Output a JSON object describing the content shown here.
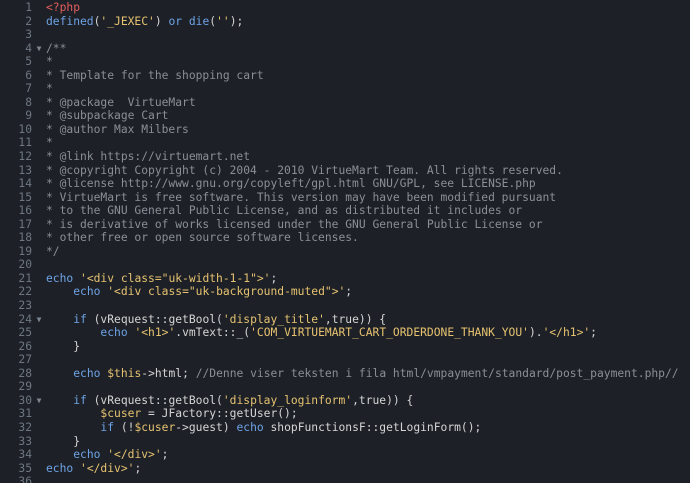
{
  "editor": {
    "lines": [
      {
        "n": "1",
        "fold": "",
        "tokens": [
          {
            "t": "<?php",
            "c": "tag"
          }
        ]
      },
      {
        "n": "2",
        "fold": "",
        "tokens": [
          {
            "t": "defined",
            "c": "kw"
          },
          {
            "t": "(",
            "c": "txt"
          },
          {
            "t": "'_JEXEC'",
            "c": "str"
          },
          {
            "t": ") ",
            "c": "txt"
          },
          {
            "t": "or",
            "c": "kw"
          },
          {
            "t": " ",
            "c": "txt"
          },
          {
            "t": "die",
            "c": "kw"
          },
          {
            "t": "(",
            "c": "txt"
          },
          {
            "t": "''",
            "c": "str"
          },
          {
            "t": ");",
            "c": "txt"
          }
        ]
      },
      {
        "n": "3",
        "fold": "",
        "tokens": []
      },
      {
        "n": "4",
        "fold": "▼",
        "tokens": [
          {
            "t": "/**",
            "c": "cmt"
          }
        ]
      },
      {
        "n": "5",
        "fold": "",
        "tokens": [
          {
            "t": "*",
            "c": "cmt"
          }
        ]
      },
      {
        "n": "6",
        "fold": "",
        "tokens": [
          {
            "t": "* Template for the shopping cart",
            "c": "cmt"
          }
        ]
      },
      {
        "n": "7",
        "fold": "",
        "tokens": [
          {
            "t": "*",
            "c": "cmt"
          }
        ]
      },
      {
        "n": "8",
        "fold": "",
        "tokens": [
          {
            "t": "* @package  VirtueMart",
            "c": "cmt"
          }
        ]
      },
      {
        "n": "9",
        "fold": "",
        "tokens": [
          {
            "t": "* @subpackage Cart",
            "c": "cmt"
          }
        ]
      },
      {
        "n": "10",
        "fold": "",
        "tokens": [
          {
            "t": "* @author Max Milbers",
            "c": "cmt"
          }
        ]
      },
      {
        "n": "11",
        "fold": "",
        "tokens": [
          {
            "t": "*",
            "c": "cmt"
          }
        ]
      },
      {
        "n": "12",
        "fold": "",
        "tokens": [
          {
            "t": "* @link https://virtuemart.net",
            "c": "cmt"
          }
        ]
      },
      {
        "n": "13",
        "fold": "",
        "tokens": [
          {
            "t": "* @copyright Copyright (c) 2004 - 2010 VirtueMart Team. All rights reserved.",
            "c": "cmt"
          }
        ]
      },
      {
        "n": "14",
        "fold": "",
        "tokens": [
          {
            "t": "* @license http://www.gnu.org/copyleft/gpl.html GNU/GPL, see LICENSE.php",
            "c": "cmt"
          }
        ]
      },
      {
        "n": "15",
        "fold": "",
        "tokens": [
          {
            "t": "* VirtueMart is free software. This version may have been modified pursuant",
            "c": "cmt"
          }
        ]
      },
      {
        "n": "16",
        "fold": "",
        "tokens": [
          {
            "t": "* to the GNU General Public License, and as distributed it includes or",
            "c": "cmt"
          }
        ]
      },
      {
        "n": "17",
        "fold": "",
        "tokens": [
          {
            "t": "* is derivative of works licensed under the GNU General Public License or",
            "c": "cmt"
          }
        ]
      },
      {
        "n": "18",
        "fold": "",
        "tokens": [
          {
            "t": "* other free or open source software licenses.",
            "c": "cmt"
          }
        ]
      },
      {
        "n": "19",
        "fold": "",
        "tokens": [
          {
            "t": "*/",
            "c": "cmt"
          }
        ]
      },
      {
        "n": "20",
        "fold": "",
        "tokens": []
      },
      {
        "n": "21",
        "fold": "",
        "tokens": [
          {
            "t": "echo",
            "c": "kw"
          },
          {
            "t": " ",
            "c": "txt"
          },
          {
            "t": "'<div class=\"uk-width-1-1\">'",
            "c": "str"
          },
          {
            "t": ";",
            "c": "txt"
          }
        ]
      },
      {
        "n": "22",
        "fold": "",
        "tokens": [
          {
            "t": "    ",
            "c": "txt"
          },
          {
            "t": "echo",
            "c": "kw"
          },
          {
            "t": " ",
            "c": "txt"
          },
          {
            "t": "'<div class=\"uk-background-muted\">'",
            "c": "str"
          },
          {
            "t": ";",
            "c": "txt"
          }
        ]
      },
      {
        "n": "23",
        "fold": "",
        "tokens": []
      },
      {
        "n": "24",
        "fold": "▼",
        "tokens": [
          {
            "t": "    ",
            "c": "txt"
          },
          {
            "t": "if",
            "c": "kw"
          },
          {
            "t": " (vRequest::getBool(",
            "c": "txt"
          },
          {
            "t": "'display_title'",
            "c": "str"
          },
          {
            "t": ",true)) {",
            "c": "txt"
          }
        ]
      },
      {
        "n": "25",
        "fold": "",
        "tokens": [
          {
            "t": "        ",
            "c": "txt"
          },
          {
            "t": "echo",
            "c": "kw"
          },
          {
            "t": " ",
            "c": "txt"
          },
          {
            "t": "'<h1>'",
            "c": "str"
          },
          {
            "t": ".vmText::_(",
            "c": "txt"
          },
          {
            "t": "'COM_VIRTUEMART_CART_ORDERDONE_THANK_YOU'",
            "c": "str"
          },
          {
            "t": ").",
            "c": "txt"
          },
          {
            "t": "'</h1>'",
            "c": "str"
          },
          {
            "t": ";",
            "c": "txt"
          }
        ]
      },
      {
        "n": "26",
        "fold": "",
        "tokens": [
          {
            "t": "    }",
            "c": "txt"
          }
        ]
      },
      {
        "n": "27",
        "fold": "",
        "tokens": []
      },
      {
        "n": "28",
        "fold": "",
        "tokens": [
          {
            "t": "    ",
            "c": "txt"
          },
          {
            "t": "echo",
            "c": "kw"
          },
          {
            "t": " ",
            "c": "txt"
          },
          {
            "t": "$this",
            "c": "var"
          },
          {
            "t": "->html; ",
            "c": "txt"
          },
          {
            "t": "//Denne viser teksten i fila html/vmpayment/standard/post_payment.php//",
            "c": "cmt"
          }
        ]
      },
      {
        "n": "29",
        "fold": "",
        "tokens": []
      },
      {
        "n": "30",
        "fold": "▼",
        "tokens": [
          {
            "t": "    ",
            "c": "txt"
          },
          {
            "t": "if",
            "c": "kw"
          },
          {
            "t": " (vRequest::getBool(",
            "c": "txt"
          },
          {
            "t": "'display_loginform'",
            "c": "str"
          },
          {
            "t": ",true)) {",
            "c": "txt"
          }
        ]
      },
      {
        "n": "31",
        "fold": "",
        "tokens": [
          {
            "t": "        ",
            "c": "txt"
          },
          {
            "t": "$cuser",
            "c": "var"
          },
          {
            "t": " = JFactory::getUser();",
            "c": "txt"
          }
        ]
      },
      {
        "n": "32",
        "fold": "",
        "tokens": [
          {
            "t": "        ",
            "c": "txt"
          },
          {
            "t": "if",
            "c": "kw"
          },
          {
            "t": " (!",
            "c": "txt"
          },
          {
            "t": "$cuser",
            "c": "var"
          },
          {
            "t": "->guest) ",
            "c": "txt"
          },
          {
            "t": "echo",
            "c": "kw"
          },
          {
            "t": " shopFunctionsF::getLoginForm();",
            "c": "txt"
          }
        ]
      },
      {
        "n": "33",
        "fold": "",
        "tokens": [
          {
            "t": "    }",
            "c": "txt"
          }
        ]
      },
      {
        "n": "34",
        "fold": "",
        "tokens": [
          {
            "t": "    ",
            "c": "txt"
          },
          {
            "t": "echo",
            "c": "kw"
          },
          {
            "t": " ",
            "c": "txt"
          },
          {
            "t": "'</div>'",
            "c": "str"
          },
          {
            "t": ";",
            "c": "txt"
          }
        ]
      },
      {
        "n": "35",
        "fold": "",
        "tokens": [
          {
            "t": "echo",
            "c": "kw"
          },
          {
            "t": " ",
            "c": "txt"
          },
          {
            "t": "'</div>'",
            "c": "str"
          },
          {
            "t": ";",
            "c": "txt"
          }
        ]
      },
      {
        "n": "36",
        "fold": "",
        "tokens": []
      }
    ]
  },
  "colors": {
    "background": "#1d2127",
    "line_number": "#6e7681",
    "php_tag": "#e35d5d",
    "keyword": "#6ea3e6",
    "string": "#e6c270",
    "comment": "#8a8f96",
    "text": "#d4d4d4"
  }
}
